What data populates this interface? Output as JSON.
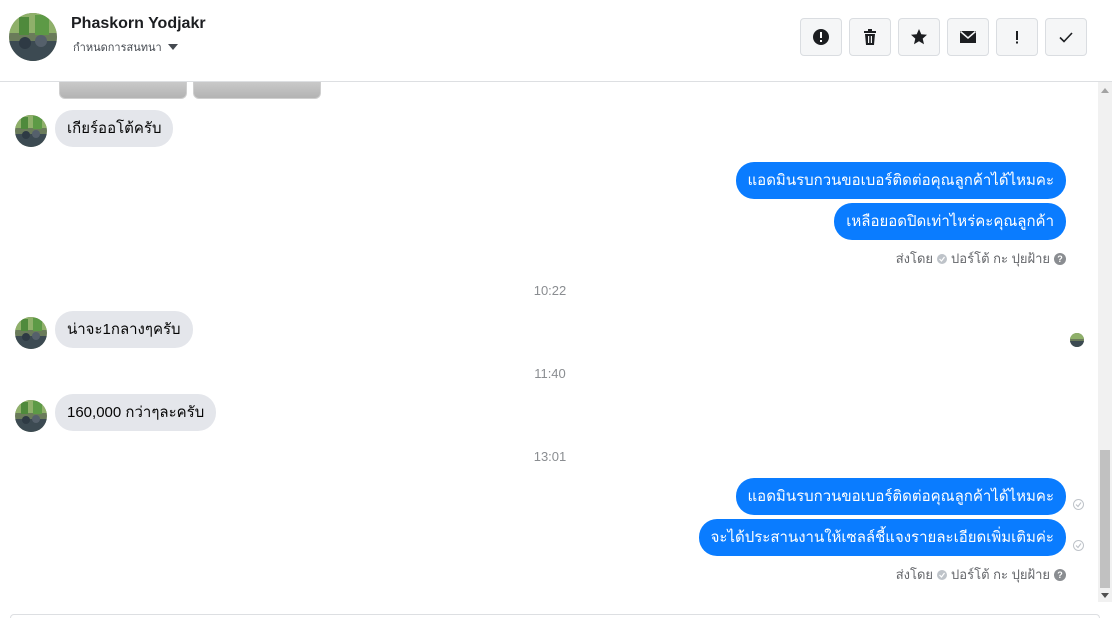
{
  "header": {
    "contact_name": "Phaskorn Yodjakr",
    "subtitle": "กำหนดการสนทนา",
    "toolbar": [
      {
        "icon": "alert-circle-icon",
        "name": "mark-spam-button"
      },
      {
        "icon": "trash-icon",
        "name": "delete-button"
      },
      {
        "icon": "star-icon",
        "name": "star-button"
      },
      {
        "icon": "envelope-icon",
        "name": "mark-unread-button"
      },
      {
        "icon": "exclamation-icon",
        "name": "important-button"
      },
      {
        "icon": "checkmark-icon",
        "name": "done-button"
      }
    ]
  },
  "messages": {
    "in_1": "เกียร์ออโต้ครับ",
    "out_1": "แอดมินรบกวนขอเบอร์ติดต่อคุณลูกค้าได้ไหมคะ",
    "out_2": "เหลือยอดปิดเท่าไหร่คะคุณลูกค้า",
    "sent_by_1": {
      "label": "ส่งโดย",
      "sender": "ปอร์โต้ กะ ปุยฝ้าย",
      "help": "?"
    },
    "time_1": "10:22",
    "in_2": "น่าจะ1กลางๆครับ",
    "time_2": "11:40",
    "in_3": "160,000 กว่าๆละครับ",
    "time_3": "13:01",
    "out_3": "แอดมินรบกวนขอเบอร์ติดต่อคุณลูกค้าได้ไหมคะ",
    "out_4": "จะได้ประสานงานให้เซลล์ชี้แจงรายละเอียดเพิ่มเติมค่ะ",
    "sent_by_2": {
      "label": "ส่งโดย",
      "sender": "ปอร์โต้ กะ ปุยฝ้าย",
      "help": "?"
    }
  },
  "colors": {
    "outgoing_bubble": "#0a7cff",
    "incoming_bubble": "#e4e6eb",
    "timestamp": "#8a8d91"
  }
}
